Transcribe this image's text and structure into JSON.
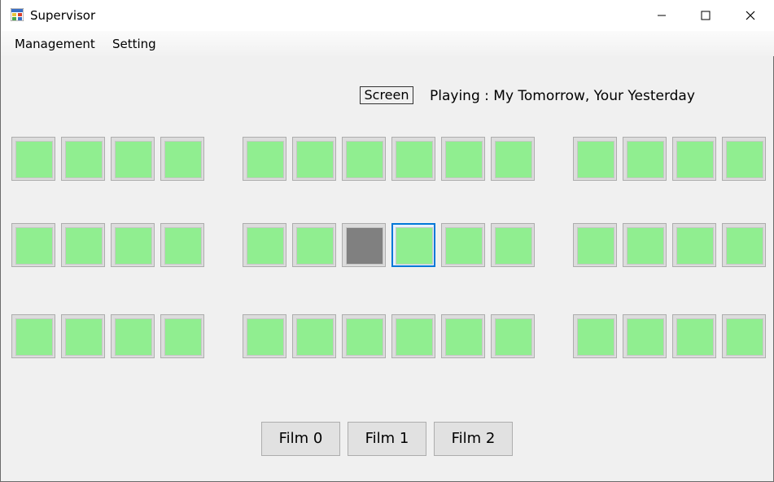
{
  "window": {
    "title": "Supervisor"
  },
  "menu": {
    "management": "Management",
    "setting": "Setting"
  },
  "screen": {
    "button_label": "Screen",
    "playing_text": "Playing : My Tomorrow, Your Yesterday"
  },
  "seats": {
    "rows": 3,
    "sections": [
      4,
      6,
      4
    ],
    "occupied": [
      {
        "row": 2,
        "col": 7
      }
    ],
    "selected": [
      {
        "row": 2,
        "col": 8
      }
    ],
    "colors": {
      "available": "#90ee90",
      "occupied": "#808080",
      "focus_border": "#0078d7"
    }
  },
  "films": [
    {
      "label": "Film 0"
    },
    {
      "label": "Film 1"
    },
    {
      "label": "Film 2"
    }
  ]
}
